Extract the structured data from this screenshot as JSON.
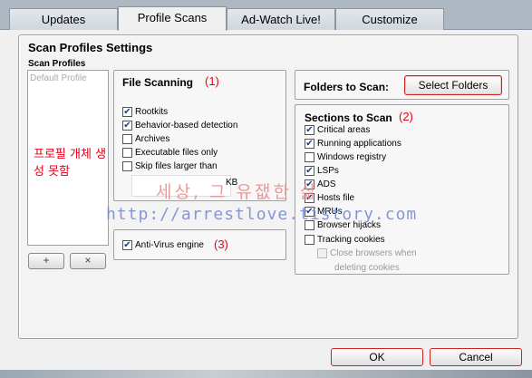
{
  "tabs": [
    {
      "label": "Updates",
      "active": false
    },
    {
      "label": "Profile Scans",
      "active": true
    },
    {
      "label": "Ad-Watch Live!",
      "active": false
    },
    {
      "label": "Customize",
      "active": false
    }
  ],
  "panel": {
    "title": "Scan Profiles Settings",
    "profiles_label": "Scan Profiles",
    "profiles": [
      "Default Profile"
    ],
    "add_label": "+",
    "remove_label": "×",
    "annotation": "프로필 개체 생성 못함"
  },
  "file_scanning": {
    "title": "File Scanning",
    "annotation": "(1)",
    "options": [
      {
        "label": "Rootkits",
        "checked": true
      },
      {
        "label": "Behavior-based detection",
        "checked": true
      },
      {
        "label": "Archives",
        "checked": false
      },
      {
        "label": "Executable files only",
        "checked": false
      },
      {
        "label": "Skip files larger than",
        "checked": false
      }
    ],
    "size_unit": "KB"
  },
  "anti_virus": {
    "label": "Anti-Virus engine",
    "checked": true,
    "annotation": "(3)"
  },
  "folders": {
    "label": "Folders to Scan:",
    "button_label": "Select Folders"
  },
  "sections": {
    "title": "Sections to Scan",
    "annotation": "(2)",
    "options": [
      {
        "label": "Critical areas",
        "checked": true
      },
      {
        "label": "Running applications",
        "checked": true
      },
      {
        "label": "Windows registry",
        "checked": false
      },
      {
        "label": "LSPs",
        "checked": true
      },
      {
        "label": "ADS",
        "checked": true
      },
      {
        "label": "Hosts file",
        "checked": true
      },
      {
        "label": "MRUs",
        "checked": true
      },
      {
        "label": "Browser hijacks",
        "checked": false
      },
      {
        "label": "Tracking cookies",
        "checked": false
      }
    ],
    "close_browsers": {
      "label_line1": "Close browsers when",
      "label_line2": "deleting cookies",
      "checked": false,
      "disabled": true
    }
  },
  "watermark": {
    "line1": "세상, 그 유잾한 삶",
    "line2": "http://arrestlove.tistory.com"
  },
  "footer": {
    "ok_label": "OK",
    "cancel_label": "Cancel"
  },
  "colors": {
    "annotation": "#e4001a",
    "check": "#1a3e8c",
    "focus_border": "#cc2222"
  }
}
